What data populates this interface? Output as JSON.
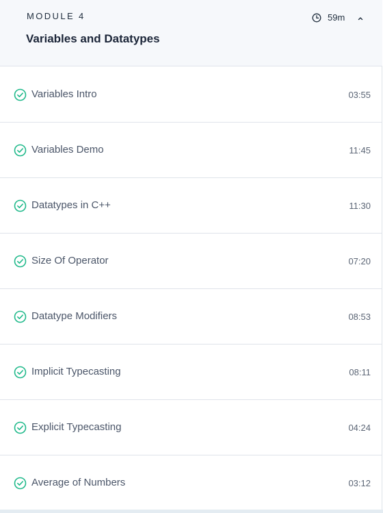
{
  "module": {
    "label": "MODULE 4",
    "title": "Variables and Datatypes",
    "duration": "59m",
    "clock_icon": "clock-icon",
    "toggle_icon": "chevron-up-icon"
  },
  "colors": {
    "accent_green": "#1fb98a",
    "header_bg": "#f6f8fb",
    "divider": "#dfe3ea"
  },
  "lessons": [
    {
      "title": "Variables Intro",
      "time": "03:55",
      "status_icon": "check-circle-icon"
    },
    {
      "title": "Variables Demo",
      "time": "11:45",
      "status_icon": "check-circle-icon"
    },
    {
      "title": "Datatypes in C++",
      "time": "11:30",
      "status_icon": "check-circle-icon"
    },
    {
      "title": "Size Of Operator",
      "time": "07:20",
      "status_icon": "check-circle-icon"
    },
    {
      "title": "Datatype Modifiers",
      "time": "08:53",
      "status_icon": "check-circle-icon"
    },
    {
      "title": "Implicit Typecasting",
      "time": "08:11",
      "status_icon": "check-circle-icon"
    },
    {
      "title": "Explicit Typecasting",
      "time": "04:24",
      "status_icon": "check-circle-icon"
    },
    {
      "title": "Average of Numbers",
      "time": "03:12",
      "status_icon": "check-circle-icon"
    }
  ]
}
